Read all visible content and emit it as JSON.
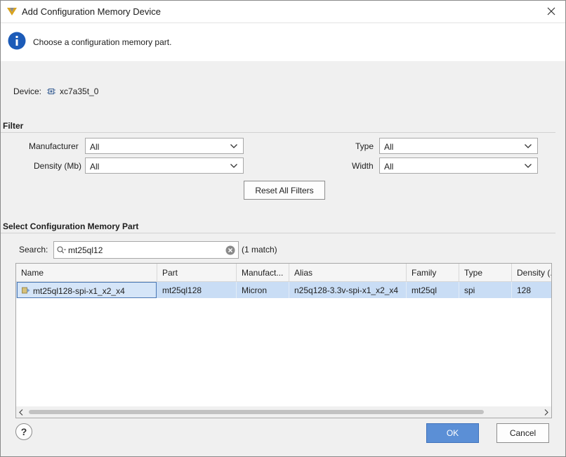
{
  "window": {
    "title": "Add Configuration Memory Device"
  },
  "banner": {
    "message": "Choose a configuration memory part."
  },
  "device": {
    "label": "Device:",
    "value": "xc7a35t_0"
  },
  "filter": {
    "section_title": "Filter",
    "manufacturer": {
      "label": "Manufacturer",
      "value": "All"
    },
    "density": {
      "label": "Density (Mb)",
      "value": "All"
    },
    "type": {
      "label": "Type",
      "value": "All"
    },
    "width": {
      "label": "Width",
      "value": "All"
    },
    "reset_label": "Reset All Filters"
  },
  "select": {
    "section_title": "Select Configuration Memory Part",
    "search_label": "Search:",
    "search_value": "mt25ql12",
    "match_count": "(1 match)"
  },
  "table": {
    "columns": [
      "Name",
      "Part",
      "Manufact...",
      "Alias",
      "Family",
      "Type",
      "Density (..."
    ],
    "rows": [
      [
        "mt25ql128-spi-x1_x2_x4",
        "mt25ql128",
        "Micron",
        "n25q128-3.3v-spi-x1_x2_x4",
        "mt25ql",
        "spi",
        "128"
      ]
    ]
  },
  "footer": {
    "help_label": "?",
    "ok_label": "OK",
    "cancel_label": "Cancel"
  },
  "colors": {
    "accent": "#5b8fd6",
    "selection": "#c9ddf5",
    "info": "#1c5bb8"
  }
}
